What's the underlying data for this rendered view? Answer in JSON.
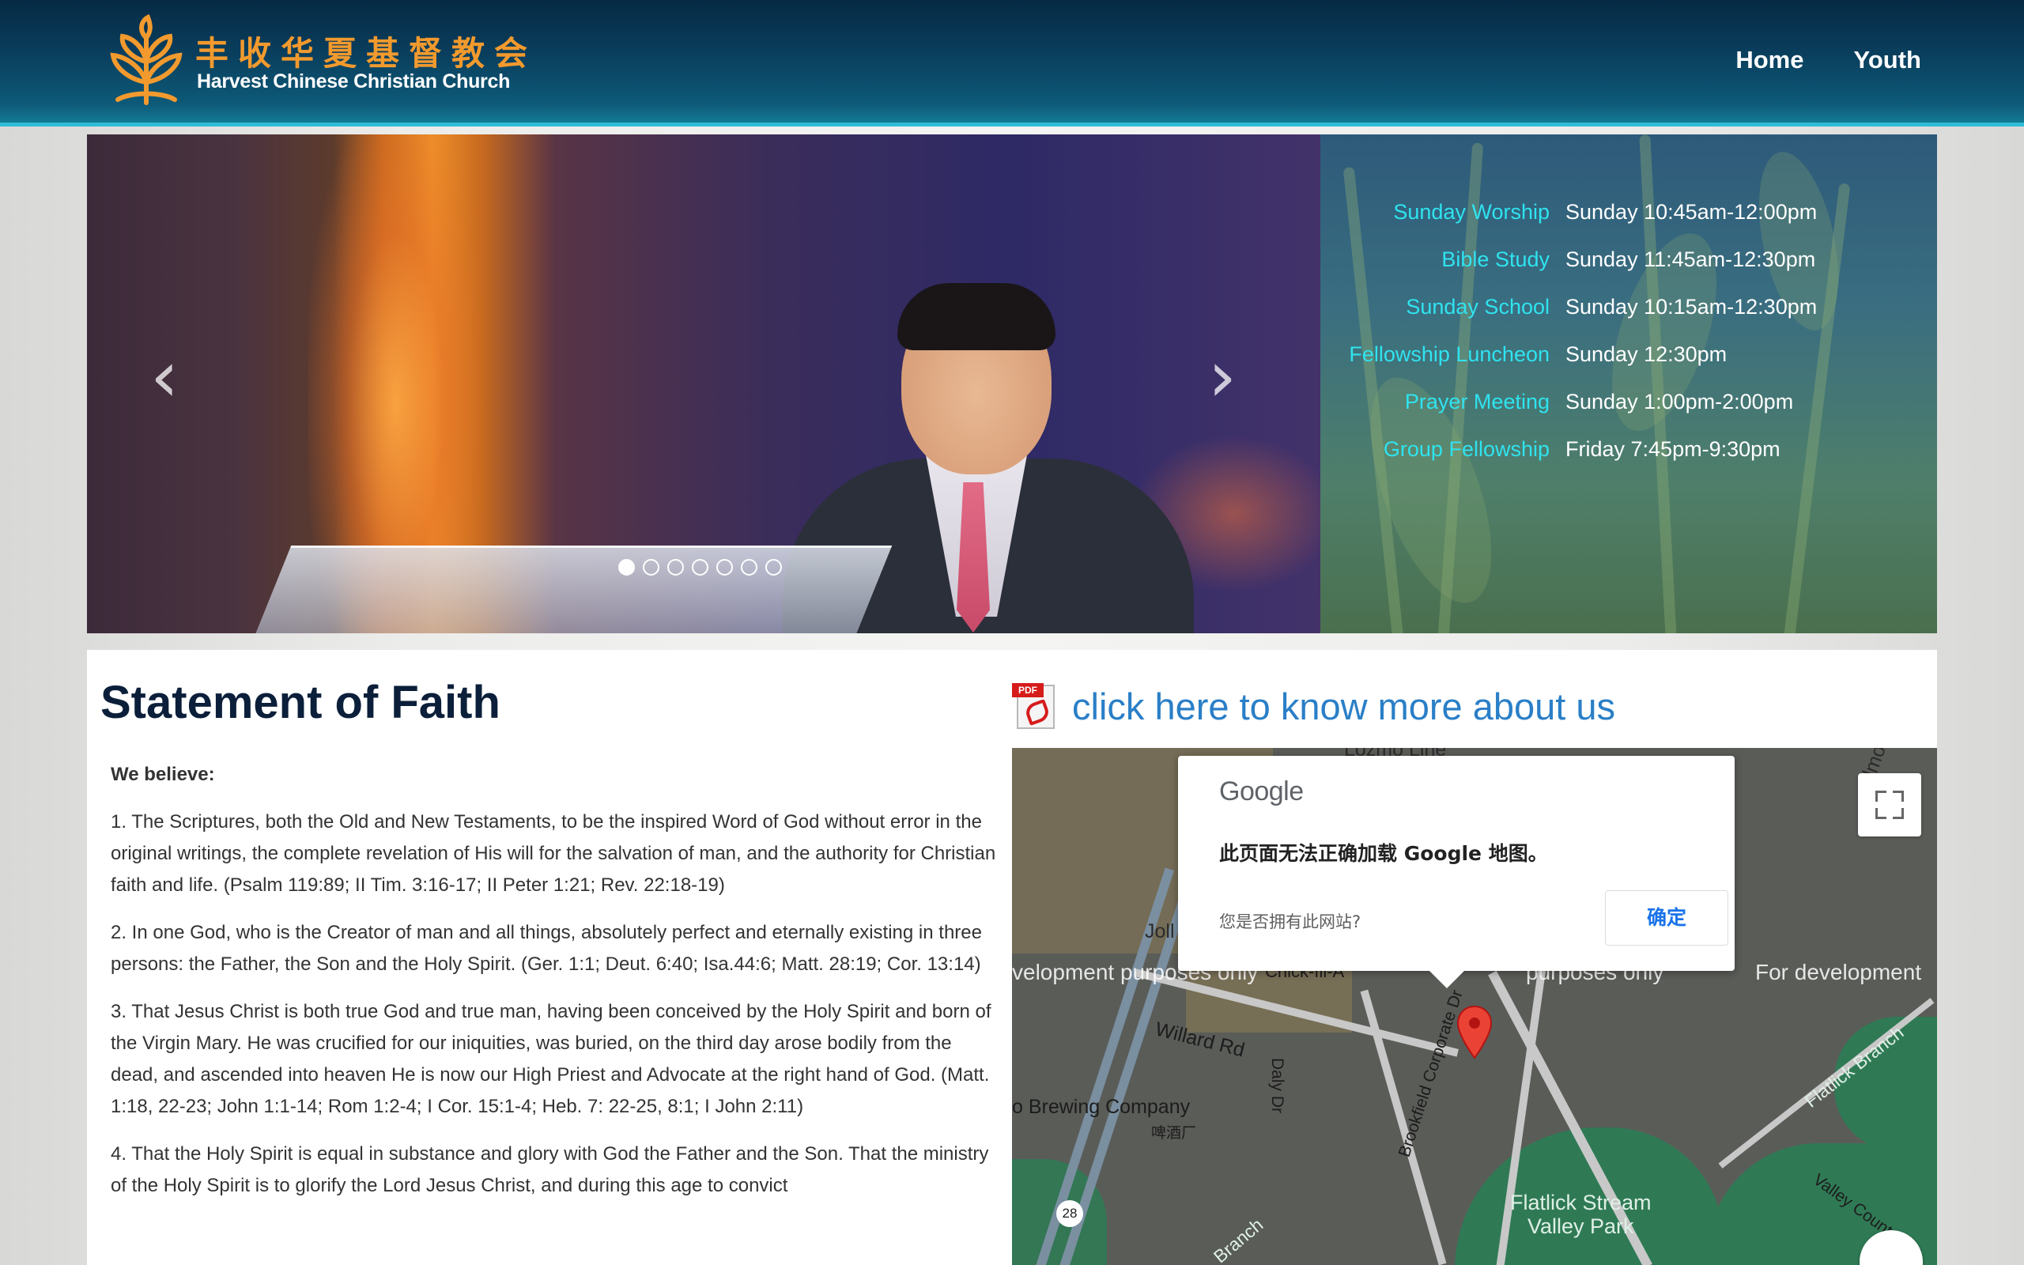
{
  "header": {
    "logo_cn": "丰收华夏基督教会",
    "logo_en": "Harvest Chinese Christian Church",
    "nav": [
      {
        "label": "Home"
      },
      {
        "label": "Youth"
      }
    ]
  },
  "carousel": {
    "prev_label": "‹",
    "next_label": "›",
    "slide_count": 7,
    "active_index": 0
  },
  "schedule": [
    {
      "name": "Sunday Worship",
      "time": "Sunday 10:45am-12:00pm"
    },
    {
      "name": "Bible Study",
      "time": "Sunday 11:45am-12:30pm"
    },
    {
      "name": "Sunday School",
      "time": "Sunday 10:15am-12:30pm"
    },
    {
      "name": "Fellowship Luncheon",
      "time": "Sunday 12:30pm"
    },
    {
      "name": "Prayer Meeting",
      "time": "Sunday 1:00pm-2:00pm"
    },
    {
      "name": "Group Fellowship",
      "time": "Friday 7:45pm-9:30pm"
    }
  ],
  "faith": {
    "title": "Statement of Faith",
    "lead": "We believe:",
    "items": [
      "1. The Scriptures, both the Old and New Testaments, to be the inspired Word of God without error in the original writings, the complete revelation of His will for the salvation of man, and the authority for Christian faith and life. (Psalm 119:89; II Tim. 3:16-17; II Peter 1:21; Rev. 22:18-19)",
      "2. In one God, who is the Creator of man and all things, absolutely perfect and eternally existing in three persons: the Father, the Son and the Holy Spirit. (Ger. 1:1; Deut. 6:40; Isa.44:6; Matt. 28:19; Cor. 13:14)",
      "3. That Jesus Christ is both true God and true man, having been conceived by the Holy Spirit and born of the Virgin Mary. He was crucified for our iniquities, was buried, on the third day arose bodily from the dead, and ascended into heaven He is now our High Priest and Advocate at the right hand of God. (Matt. 1:18, 22-23; John 1:1-14; Rom 1:2-4; I Cor. 15:1-4; Heb. 7: 22-25, 8:1; I John 2:11)",
      "4. That the Holy Spirit is equal in substance and glory with God the Father and the Son. That the ministry of the Holy Spirit is to glorify the Lord Jesus Christ, and during this age to convict"
    ]
  },
  "about": {
    "pdf_tag": "PDF",
    "link_text": "click here to know more about us"
  },
  "map": {
    "dialog_logo": "Google",
    "dialog_message": "此页面无法正确加载 Google 地图。",
    "dialog_question": "您是否拥有此网站?",
    "dialog_ok": "确定",
    "labels": {
      "top_partial": "Lozmo Line",
      "elmo": "Elmo",
      "jolly": "Joll",
      "willard": "Willard Rd",
      "daly": "Daly Dr",
      "brookfield": "Brookfield Corporate Dr",
      "brewing": "o Brewing Company",
      "brewing_cn": "啤酒厂",
      "park": "Flatlick Stream\nValley Park",
      "flatlick_branch": "Flatlick Branch",
      "valley_country": "Valley Country Dr",
      "route": "28",
      "branch": "Branch",
      "chick": "Chick-fil-A",
      "dev1": "velopment purposes only",
      "dev2": "purposes only",
      "dev3": "For development"
    }
  }
}
